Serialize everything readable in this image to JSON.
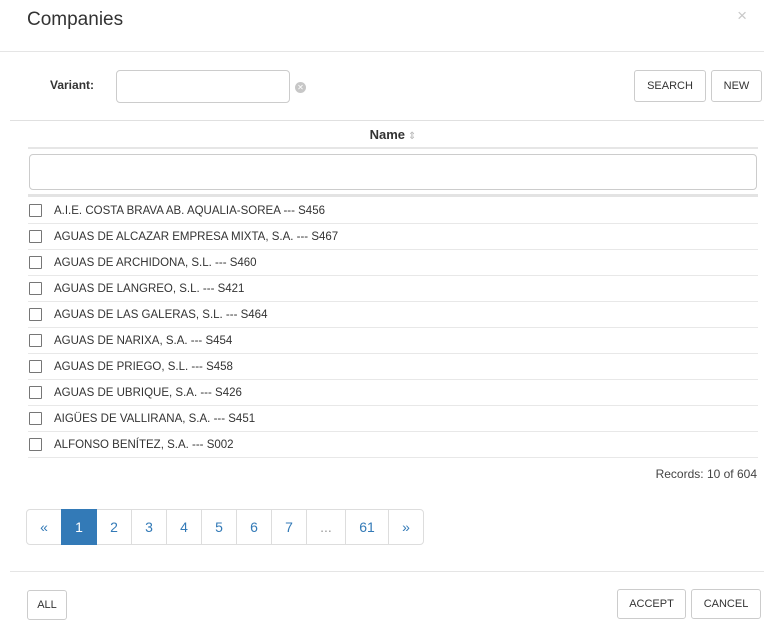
{
  "modal": {
    "title": "Companies",
    "close_glyph": "×"
  },
  "search": {
    "variant_label": "Variant:",
    "variant_value": "",
    "clear_glyph": "✕",
    "search_label": "SEARCH",
    "new_label": "NEW"
  },
  "table": {
    "column_header": "Name",
    "sort_glyph": "⇕",
    "filter_value": "",
    "rows": [
      {
        "label": "A.I.E. COSTA BRAVA AB. AQUALIA-SOREA --- S456",
        "checked": false
      },
      {
        "label": "AGUAS DE ALCAZAR EMPRESA MIXTA, S.A. --- S467",
        "checked": false
      },
      {
        "label": "AGUAS DE ARCHIDONA, S.L. --- S460",
        "checked": false
      },
      {
        "label": "AGUAS DE LANGREO, S.L. --- S421",
        "checked": false
      },
      {
        "label": "AGUAS DE LAS GALERAS, S.L. --- S464",
        "checked": false
      },
      {
        "label": "AGUAS DE NARIXA, S.A. --- S454",
        "checked": false
      },
      {
        "label": "AGUAS DE PRIEGO, S.L. --- S458",
        "checked": false
      },
      {
        "label": "AGUAS DE UBRIQUE, S.A. --- S426",
        "checked": false
      },
      {
        "label": "AIGÜES DE VALLIRANA, S.A. --- S451",
        "checked": false
      },
      {
        "label": "ALFONSO BENÍTEZ, S.A. --- S002",
        "checked": false
      }
    ]
  },
  "records": "Records: 10 of 604",
  "pagination": {
    "pages": [
      {
        "label": "«",
        "name": "page-first",
        "active": false,
        "disabled": false
      },
      {
        "label": "1",
        "name": "page-1",
        "active": true,
        "disabled": false
      },
      {
        "label": "2",
        "name": "page-2",
        "active": false,
        "disabled": false
      },
      {
        "label": "3",
        "name": "page-3",
        "active": false,
        "disabled": false
      },
      {
        "label": "4",
        "name": "page-4",
        "active": false,
        "disabled": false
      },
      {
        "label": "5",
        "name": "page-5",
        "active": false,
        "disabled": false
      },
      {
        "label": "6",
        "name": "page-6",
        "active": false,
        "disabled": false
      },
      {
        "label": "7",
        "name": "page-7",
        "active": false,
        "disabled": false
      },
      {
        "label": "...",
        "name": "page-ellipsis",
        "active": false,
        "disabled": true
      },
      {
        "label": "61",
        "name": "page-61",
        "active": false,
        "disabled": false
      },
      {
        "label": "»",
        "name": "page-next",
        "active": false,
        "disabled": false
      }
    ]
  },
  "footer": {
    "all_label": "ALL",
    "accept_label": "ACCEPT",
    "cancel_label": "CANCEL"
  },
  "colors": {
    "accent": "#337ab7",
    "border": "#cccccc",
    "text": "#333333"
  }
}
